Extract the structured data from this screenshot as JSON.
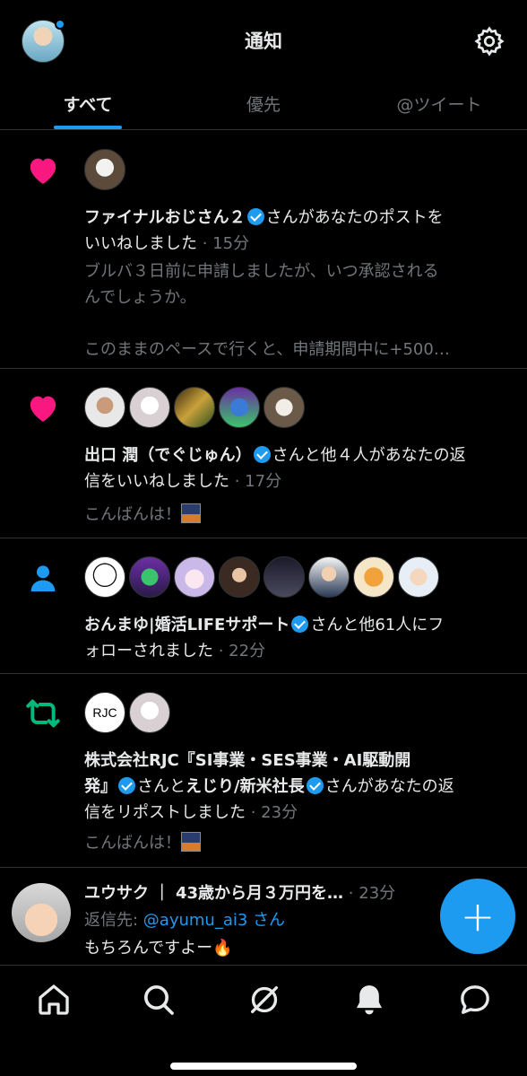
{
  "header": {
    "title": "通知"
  },
  "tabs": [
    {
      "label": "すべて",
      "active": true
    },
    {
      "label": "優先",
      "active": false
    },
    {
      "label": "@ツイート",
      "active": false
    }
  ],
  "notifications": [
    {
      "type": "like",
      "icon": "heart-icon",
      "name": "ファイナルおじさん２",
      "action": "さんがあなたのポストを",
      "action2": "いいねしました",
      "time": "· 15分",
      "preview1": "ブルバ３日前に申請しましたが、いつ承認される",
      "preview2": "んでしょうか。",
      "preview3": "このままのペースで行くと、申請期間中に+500…"
    },
    {
      "type": "like",
      "icon": "heart-icon",
      "name": "出口 潤（でぐじゅん）",
      "action": "さんと他４人があなたの返",
      "action2": "信をいいねしました",
      "time": "· 17分",
      "preview": "こんばんは！"
    },
    {
      "type": "follow",
      "icon": "person-icon",
      "name": "おんまゆ|婚活LIFEサポート",
      "action": "さんと他61人にフ",
      "action2": "ォローされました",
      "time": "· 22分"
    },
    {
      "type": "repost",
      "icon": "repost-icon",
      "name": "株式会社RJC『SI事業・SES事業・AI駆動開",
      "name_cont": "発』",
      "mid": "さんと",
      "name2": "えじり/新米社長",
      "action": "さんがあなたの返",
      "action2": "信をリポストしました",
      "time": "· 23分",
      "preview": "こんばんは！",
      "avatar_text": "RJC"
    }
  ],
  "reply": {
    "name": "ユウサク",
    "bio": "｜ 43歳から月３万円を…",
    "time": "· 23分",
    "reply_prefix": "返信先: ",
    "reply_to": "@ayumu_ai3 さん",
    "text": "もちろんですよー🔥"
  },
  "fab": {
    "label": "+"
  },
  "nav": [
    "home-icon",
    "search-icon",
    "grok-icon",
    "notifications-icon",
    "messages-icon"
  ]
}
